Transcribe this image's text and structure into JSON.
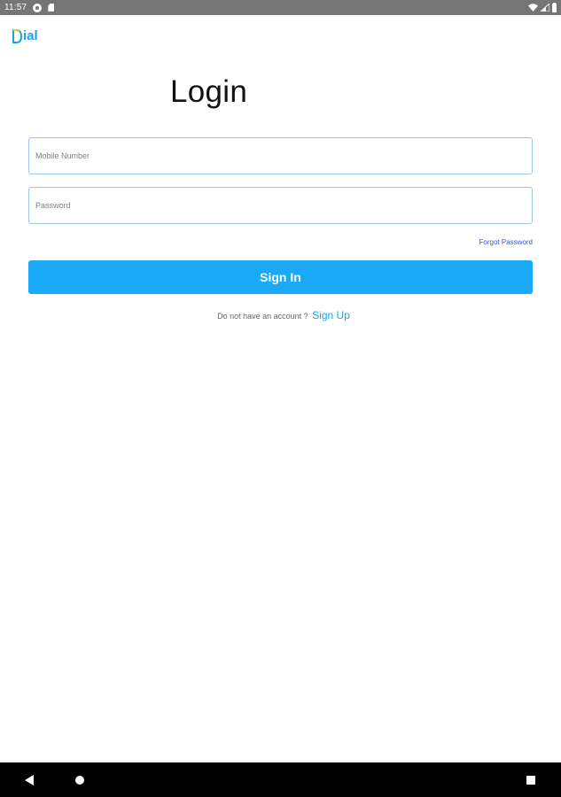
{
  "status_bar": {
    "time": "11:57",
    "icons": [
      "notification-icon",
      "sd-card-icon",
      "wifi-icon",
      "signal-icon",
      "battery-icon"
    ]
  },
  "app": {
    "logo_text": "ial",
    "brand_color": "#1aa3e8"
  },
  "login": {
    "title": "Login",
    "mobile_placeholder": "Mobile Number",
    "password_placeholder": "Password",
    "forgot_password": "Forgot Password",
    "signin_label": "Sign In",
    "signup_prompt": "Do not have an account ?",
    "signup_link": "Sign Up",
    "button_color": "#1aa9f6"
  },
  "nav_bar": {
    "icons": [
      "back-icon",
      "home-icon",
      "recents-icon"
    ]
  }
}
